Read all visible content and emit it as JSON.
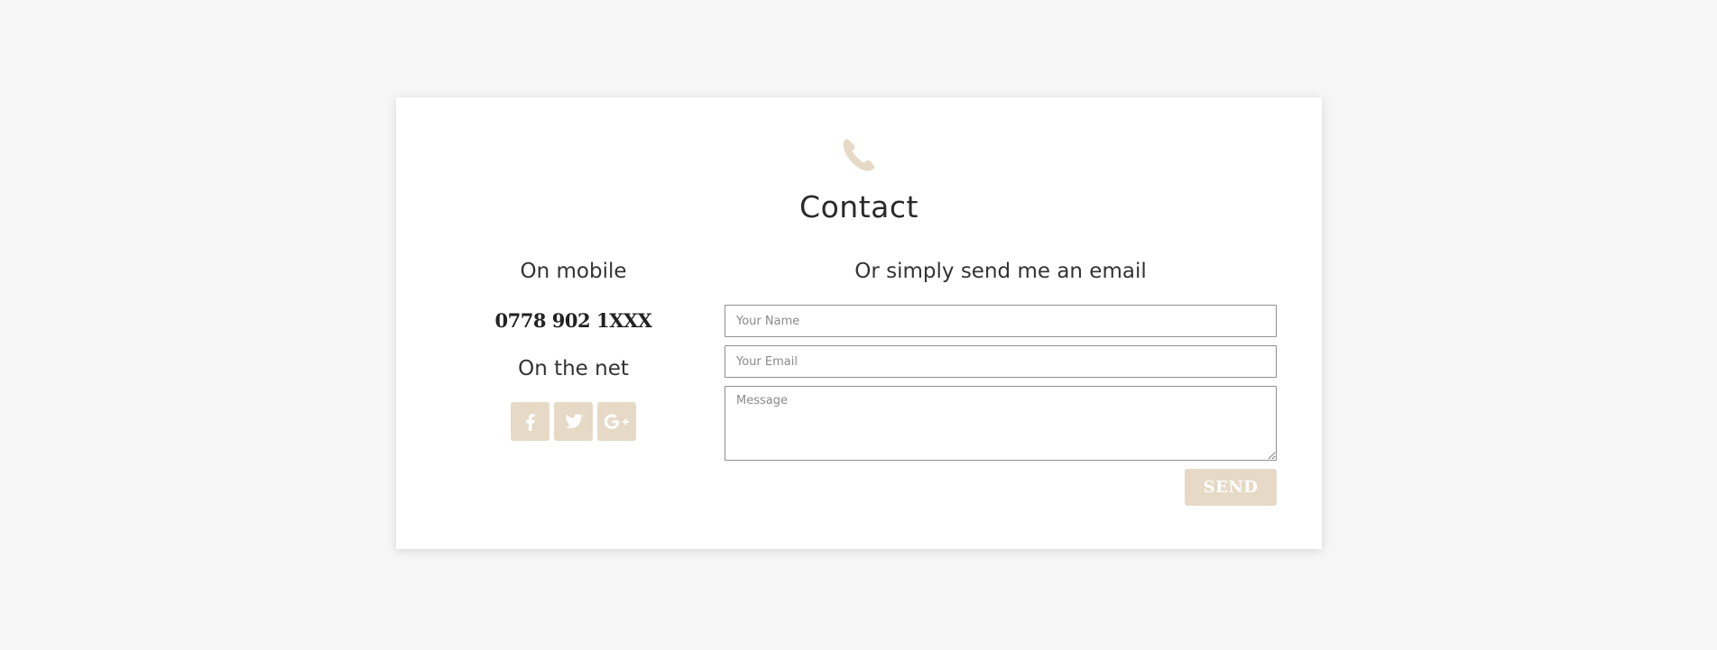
{
  "colors": {
    "page_background": "#f6f6f6",
    "card_background": "#ffffff",
    "accent": "#e6dac6",
    "heading_text": "#333333",
    "input_border": "#8f8f8f"
  },
  "header": {
    "icon": "phone-icon",
    "title": "Contact"
  },
  "left": {
    "mobile_heading": "On mobile",
    "phone_number": "0778 902 1XXX",
    "net_heading": "On the net",
    "socials": [
      {
        "icon": "facebook-icon",
        "glyph": "f"
      },
      {
        "icon": "twitter-icon",
        "glyph": ""
      },
      {
        "icon": "google-plus-icon",
        "glyph": "G+"
      }
    ]
  },
  "form": {
    "heading": "Or simply send me an email",
    "name_placeholder": "Your Name",
    "email_placeholder": "Your Email",
    "message_placeholder": "Message",
    "send_label": "SEND"
  }
}
